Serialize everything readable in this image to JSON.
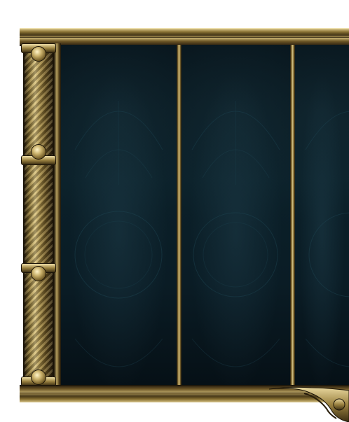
{
  "scene": {
    "panel_count": 3,
    "colors": {
      "gold_light": "#d9c68c",
      "gold_mid": "#8c7436",
      "gold_dark": "#2b2010",
      "panel_dark": "#07141b",
      "panel_mid": "#0b2029",
      "ornament_line": "#1f4654"
    }
  }
}
